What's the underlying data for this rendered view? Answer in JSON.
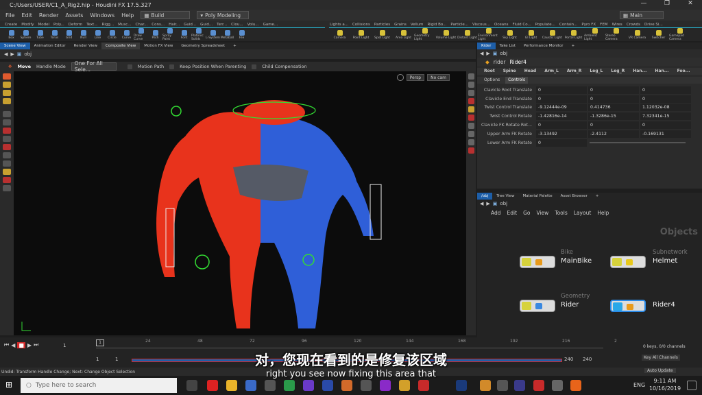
{
  "window": {
    "title": "C:/Users/USER/C1_A_Rig2.hip - Houdini FX 17.5.327"
  },
  "menubar": {
    "items": [
      "File",
      "Edit",
      "Render",
      "Assets",
      "Windows",
      "Help"
    ],
    "build_dropdown": "Build",
    "desktop_dropdown": "Poly Modeling",
    "main_dropdown": "Main"
  },
  "shelf": {
    "tabs_left": [
      "Create",
      "Modify",
      "Model",
      "Poly...",
      "Deform",
      "Text...",
      "Rigg...",
      "Musc...",
      "Char...",
      "Cons...",
      "Hair...",
      "Guid...",
      "Guid...",
      "Terr...",
      "Clou...",
      "Volu...",
      "Game..."
    ],
    "tabs_right": [
      "Lights a...",
      "Collisions",
      "Particles",
      "Grains",
      "Vellum",
      "Rigid Bo...",
      "Particle...",
      "Viscous...",
      "Oceans",
      "Fluid Co...",
      "Populate...",
      "Contain...",
      "Pyro FX",
      "FEM",
      "Wires",
      "Crowds",
      "Drive Si..."
    ],
    "tools_left": [
      "Box",
      "Sphere",
      "Tube",
      "Torus",
      "Grid",
      "Null",
      "Line",
      "Circle",
      "Curve",
      "Draw Curve",
      "Path",
      "Spray Paint",
      "Font",
      "Platonic Solids",
      "L-System",
      "Metaball",
      "File"
    ],
    "tools_right": [
      "Camera",
      "Point Light",
      "Spot Light",
      "Area Light",
      "Geometry Light",
      "Volume Light",
      "Distant Light",
      "Environment Light",
      "Sky Light",
      "GI Light",
      "Caustic Light",
      "Portal Light",
      "Ambient Light",
      "Stereo Camera",
      "VR Camera",
      "Switcher",
      "Gamepad Camera"
    ]
  },
  "left_panes": {
    "tabs": [
      "Scene View",
      "Animation Editor",
      "Render View",
      "Composite View",
      "Motion FX View",
      "Geometry Spreadsheet"
    ],
    "active_tab": "Composite View",
    "path": "obj"
  },
  "tool_options": {
    "tool": "Move",
    "handle_mode_label": "Handle Mode",
    "handle_mode_value": "One For All Sele...",
    "motion_path": "Motion Path",
    "keep_position": "Keep Position When Parenting",
    "child_comp": "Child Compensation"
  },
  "viewport": {
    "persp": "Persp",
    "camera": "No cam"
  },
  "params": {
    "tabs": [
      "Rider",
      "Take List",
      "Performance Monitor"
    ],
    "active_tab": "Rider",
    "node_type": "rider",
    "node_name": "Rider4",
    "top_tabs": [
      "Root",
      "Spine",
      "Head",
      "Arm_L",
      "Arm_R",
      "Leg_L",
      "Leg_R",
      "Han...",
      "Han...",
      "Foo..."
    ],
    "sub_tabs": [
      "Options",
      "Controls"
    ],
    "rows": [
      {
        "label": "Clavicle Root Translate",
        "values": [
          "0",
          "0",
          "0"
        ]
      },
      {
        "label": "Clavicle End Translate",
        "values": [
          "0",
          "0",
          "0"
        ]
      },
      {
        "label": "Twist Control Translate",
        "values": [
          "-9.12444e-09",
          "0.414736",
          "1.12032e-08"
        ]
      },
      {
        "label": "Twist Control Rotate",
        "values": [
          "-1.42816e-14",
          "-1.3286e-15",
          "7.32341e-15"
        ]
      },
      {
        "label": "Clavicle FK Rotate Rot...",
        "values": [
          "0",
          "0",
          "0"
        ]
      },
      {
        "label": "Upper Arm FK Rotate",
        "values": [
          "-3.13492",
          "-2.4112",
          "-0.169131"
        ]
      },
      {
        "label": "Lower Arm FK Rotate",
        "values": [
          "0"
        ]
      }
    ]
  },
  "network": {
    "tabs": [
      "/obj",
      "Tree View",
      "Material Palette",
      "Asset Browser"
    ],
    "path": "obj",
    "menu": [
      "Add",
      "Edit",
      "Go",
      "View",
      "Tools",
      "Layout",
      "Help"
    ],
    "context_label": "Objects",
    "nodes": [
      {
        "sub": "Bike",
        "name": "MainBike"
      },
      {
        "sub": "Subnetwork",
        "name": "Helmet"
      },
      {
        "sub": "Geometry",
        "name": "Rider"
      },
      {
        "sub": "",
        "name": "Rider4"
      }
    ]
  },
  "timeline": {
    "ticks": [
      "24",
      "48",
      "72",
      "96",
      "120",
      "144",
      "168",
      "192",
      "216",
      "2"
    ],
    "current_frame": "1",
    "start": "1",
    "start2": "1",
    "end": "240",
    "end2": "240",
    "keys": "0 keys, 0/0 channels",
    "key_all": "Key All Channels",
    "auto_update": "Auto Update"
  },
  "status": {
    "text": "Undid: Transform Handle Change; Next: Change Object Selection"
  },
  "taskbar": {
    "search_placeholder": "Type here to search",
    "lang": "ENG",
    "time": "9:11 AM",
    "date": "10/16/2019"
  },
  "subtitles": {
    "zh": "对，您现在看到的是修复该区域",
    "en": "right you see now fixing this area that"
  }
}
